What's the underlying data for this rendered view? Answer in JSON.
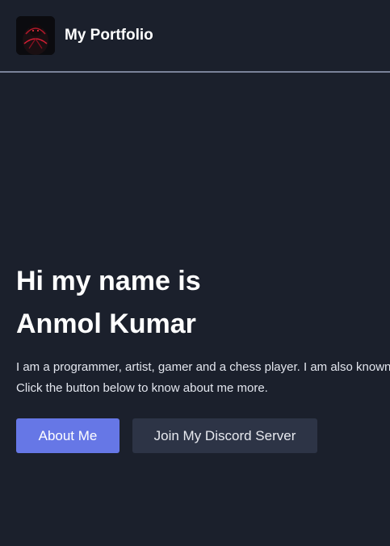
{
  "navbar": {
    "brand_name": "My Portfolio"
  },
  "hero": {
    "greeting": "Hi my name is",
    "name": "Anmol Kumar",
    "description_line1": "I am a programmer, artist, gamer and a chess player. I am also known as",
    "description_line2": "Click the button below to know about me more."
  },
  "actions": {
    "about_label": "About Me",
    "discord_label": "Join My Discord Server"
  },
  "colors": {
    "background": "#1b202c",
    "primary_button": "#6677e6",
    "secondary_button": "#2d3446",
    "divider": "#7a8399"
  }
}
